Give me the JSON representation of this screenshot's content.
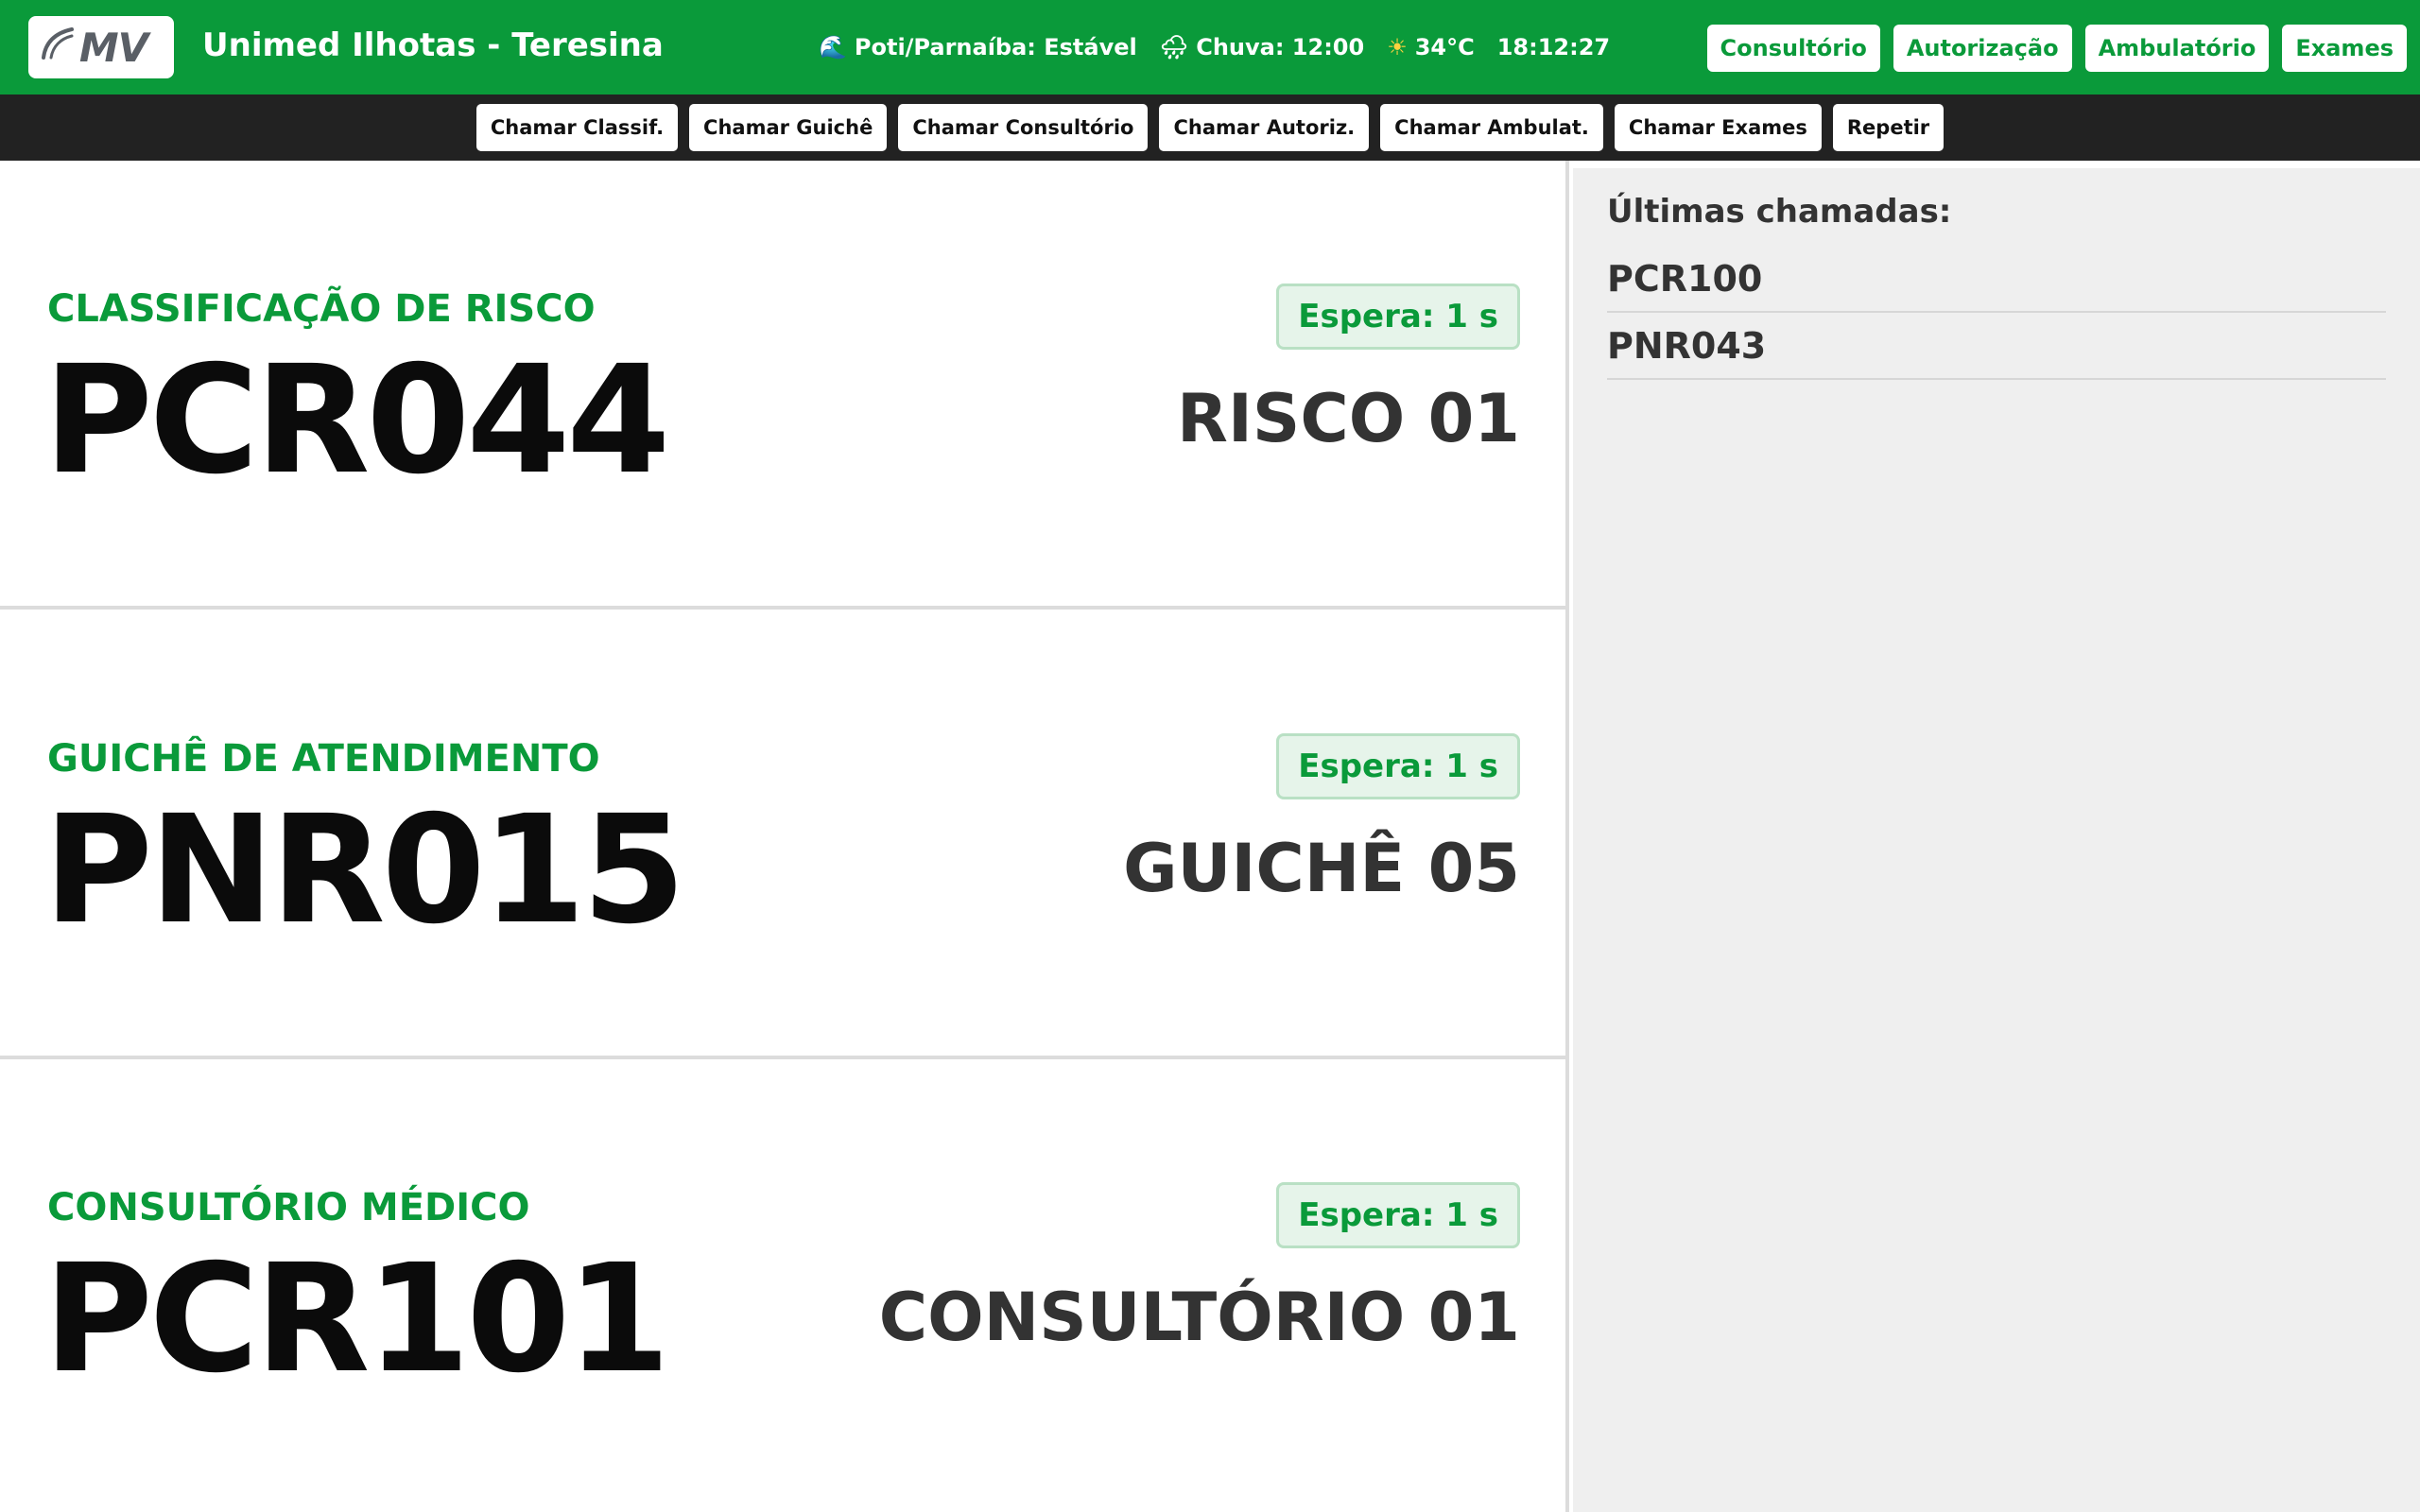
{
  "header": {
    "logo_text": "MV",
    "title": "Unimed Ilhotas - Teresina",
    "status": [
      {
        "icon": "wave-icon",
        "glyph": "🌊",
        "text": "Poti/Parnaíba: Estável"
      },
      {
        "icon": "rain-cloud-icon",
        "glyph": "🌧",
        "text": "Chuva: 12:00"
      },
      {
        "icon": "sun-icon",
        "glyph": "☀",
        "text": "34°C"
      },
      {
        "icon": "clock",
        "glyph": "",
        "text": "18:12:27"
      }
    ],
    "nav": [
      "Consultório",
      "Autorização",
      "Ambulatório",
      "Exames"
    ]
  },
  "actions": [
    "Chamar Classif.",
    "Chamar Guichê",
    "Chamar Consultório",
    "Chamar Autoriz.",
    "Chamar Ambulat.",
    "Chamar Exames",
    "Repetir"
  ],
  "panels": [
    {
      "title": "CLASSIFICAÇÃO DE RISCO",
      "ticket": "PCR044",
      "wait": "Espera: 1 s",
      "location": "RISCO 01"
    },
    {
      "title": "GUICHÊ DE ATENDIMENTO",
      "ticket": "PNR015",
      "wait": "Espera: 1 s",
      "location": "GUICHÊ 05"
    },
    {
      "title": "CONSULTÓRIO MÉDICO",
      "ticket": "PCR101",
      "wait": "Espera: 1 s",
      "location": "CONSULTÓRIO 01"
    }
  ],
  "sidebar": {
    "title": "Últimas chamadas:",
    "recent": [
      "PCR100",
      "PNR043"
    ]
  },
  "colors": {
    "brand_green": "#0a9a3a",
    "action_bar": "#222222",
    "sidebar_bg": "#efefef",
    "wait_badge_bg": "#e6f4ea"
  }
}
